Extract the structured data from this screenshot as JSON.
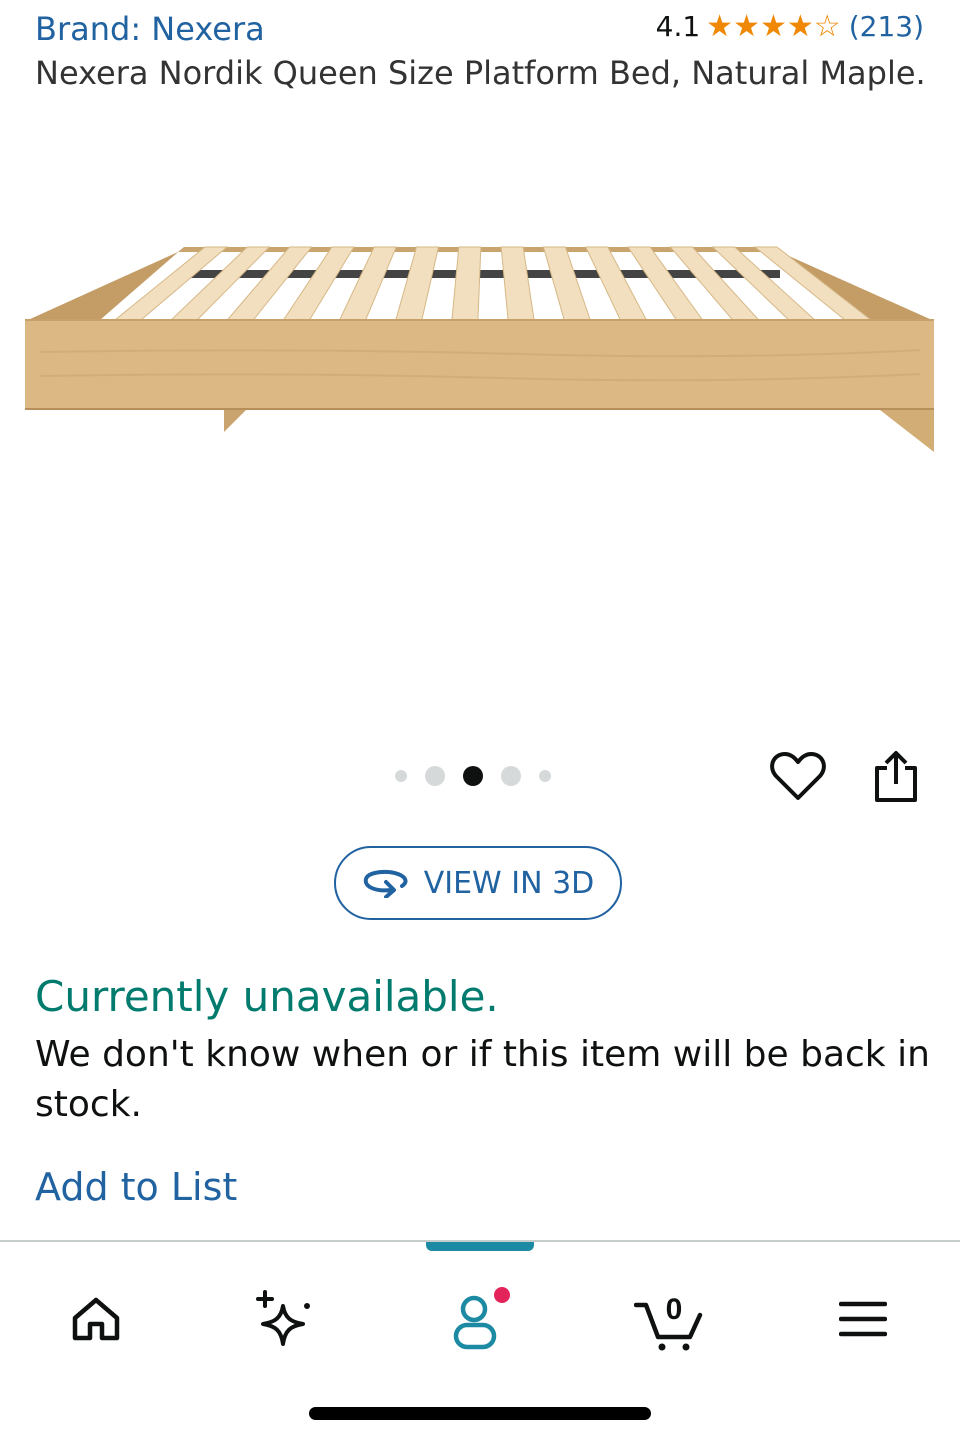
{
  "product": {
    "brand_label": "Brand: Nexera",
    "rating_value": "4.1",
    "rating_stars": 4.1,
    "review_count": "(213)",
    "title": "Nexera Nordik Queen Size Platform Bed, Natural Maple.",
    "image_icon": "platform-bed-image"
  },
  "carousel": {
    "dot_count": 5,
    "active_index": 2
  },
  "actions": {
    "wishlist_icon": "heart-icon",
    "share_icon": "share-icon",
    "view_3d_label": "VIEW IN 3D",
    "view_3d_icon": "rotate-3d-icon"
  },
  "availability": {
    "status": "Currently unavailable.",
    "description": "We don't know when or if this item will be back in stock."
  },
  "add_to_list_label": "Add to List",
  "bottom_nav": {
    "items": [
      {
        "icon": "home-icon"
      },
      {
        "icon": "sparkle-icon"
      },
      {
        "icon": "account-icon",
        "active": true,
        "notification": true
      },
      {
        "icon": "cart-icon",
        "badge": "0"
      },
      {
        "icon": "menu-icon"
      }
    ]
  },
  "colors": {
    "link": "#2162a1",
    "available_green": "#007b6e",
    "star": "#f08804",
    "nav_accent": "#1d8aa3",
    "notification": "#e3245a",
    "wood": "#dcb884"
  }
}
